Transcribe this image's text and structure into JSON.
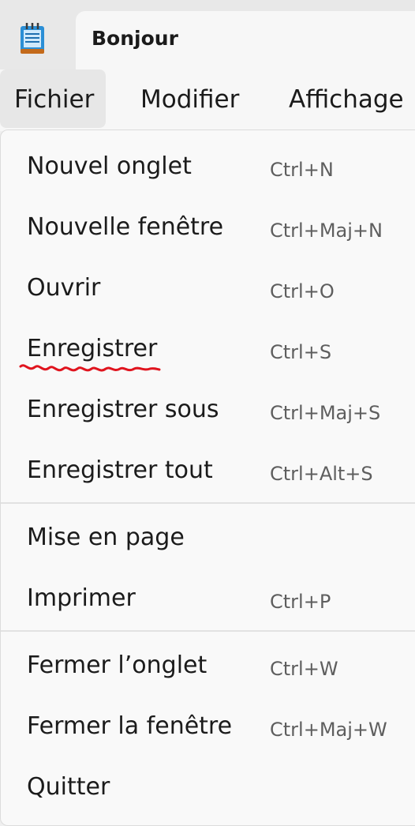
{
  "window": {
    "tab_title": "Bonjour",
    "app_icon": "notepad-icon"
  },
  "menubar": {
    "items": [
      "Fichier",
      "Modifier",
      "Affichage"
    ],
    "active": "Fichier"
  },
  "dropdown": {
    "groups": [
      [
        {
          "label": "Nouvel onglet",
          "shortcut": "Ctrl+N"
        },
        {
          "label": "Nouvelle fenêtre",
          "shortcut": "Ctrl+Maj+N"
        },
        {
          "label": "Ouvrir",
          "shortcut": "Ctrl+O"
        },
        {
          "label": "Enregistrer",
          "shortcut": "Ctrl+S"
        },
        {
          "label": "Enregistrer sous",
          "shortcut": "Ctrl+Maj+S"
        },
        {
          "label": "Enregistrer tout",
          "shortcut": "Ctrl+Alt+S"
        }
      ],
      [
        {
          "label": "Mise en page",
          "shortcut": ""
        },
        {
          "label": "Imprimer",
          "shortcut": "Ctrl+P"
        }
      ],
      [
        {
          "label": "Fermer l’onglet",
          "shortcut": "Ctrl+W"
        },
        {
          "label": "Fermer la fenêtre",
          "shortcut": "Ctrl+Maj+W"
        },
        {
          "label": "Quitter",
          "shortcut": ""
        }
      ]
    ]
  },
  "colors": {
    "annotation": "#e0141e"
  }
}
